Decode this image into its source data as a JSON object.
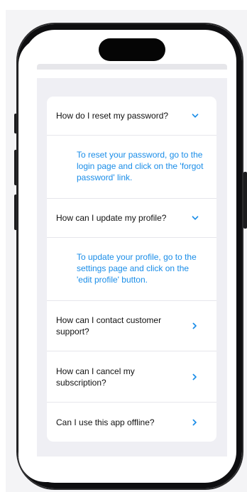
{
  "faq": {
    "items": [
      {
        "question": "How do I reset my password?",
        "answer": "To reset your password, go to the login page and click on the 'forgot password' link.",
        "expanded": true,
        "chevron": "chevron-down-icon"
      },
      {
        "question": "How can I update my profile?",
        "answer": "To update your profile, go to the settings page and click on the 'edit profile' button.",
        "expanded": true,
        "chevron": "chevron-down-icon"
      },
      {
        "question": "How can I contact customer support?",
        "expanded": false,
        "chevron": "chevron-right-icon"
      },
      {
        "question": "How can I cancel my subscription?",
        "expanded": false,
        "chevron": "chevron-right-icon"
      },
      {
        "question": "Can I use this app offline?",
        "expanded": false,
        "chevron": "chevron-right-icon"
      }
    ]
  },
  "colors": {
    "accent": "#1a8de8",
    "question_text": "#111111",
    "background": "#efeff4",
    "card": "#ffffff"
  }
}
